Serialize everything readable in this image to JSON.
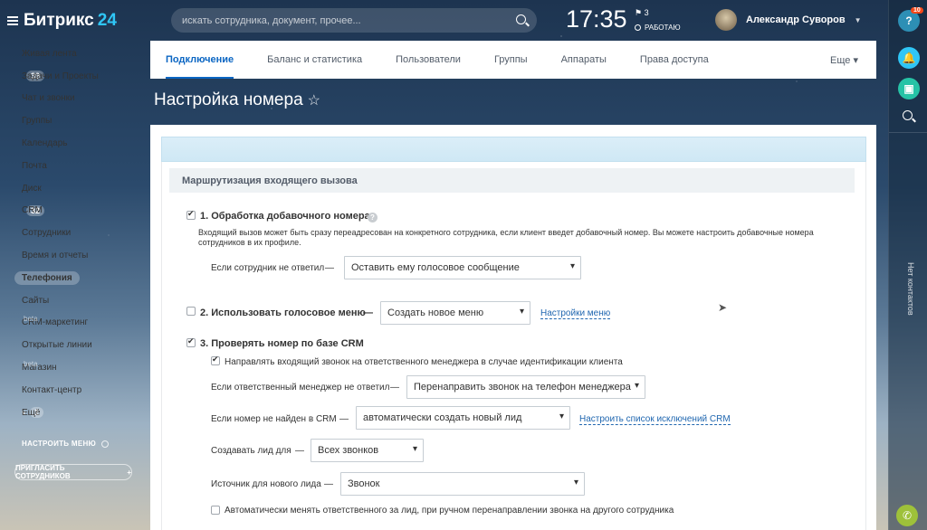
{
  "sidebar": {
    "logo": "Битрикс",
    "logo_num": "24",
    "items": [
      {
        "label": "Живая лента",
        "badge": ""
      },
      {
        "label": "Задачи и Проекты",
        "badge": "39"
      },
      {
        "label": "Чат и звонки",
        "badge": ""
      },
      {
        "label": "Группы",
        "badge": ""
      },
      {
        "label": "Календарь",
        "badge": ""
      },
      {
        "label": "Почта",
        "badge": ""
      },
      {
        "label": "Диск",
        "badge": ""
      },
      {
        "label": "CRM",
        "badge": "32"
      },
      {
        "label": "Сотрудники",
        "badge": ""
      },
      {
        "label": "Время и отчеты",
        "badge": ""
      },
      {
        "label": "Телефония",
        "badge": "",
        "active": true
      },
      {
        "label": "Сайты",
        "badge": ""
      },
      {
        "label": "CRM-маркетинг",
        "beta": "beta"
      },
      {
        "label": "Открытые линии",
        "badge": ""
      },
      {
        "label": "Магазин",
        "beta": "beta"
      },
      {
        "label": "Контакт-центр",
        "badge": ""
      },
      {
        "label": "Ещё",
        "badge": "1"
      }
    ],
    "configure": "НАСТРОИТЬ МЕНЮ",
    "invite": "ПРИГЛАСИТЬ СОТРУДНИКОВ"
  },
  "topbar": {
    "search_placeholder": "искать сотрудника, документ, прочее...",
    "clock": "17:35",
    "flag_count": "3",
    "work_status": "РАБОТАЮ",
    "user_name": "Александр Суворов"
  },
  "right_panel": {
    "help_count": "10",
    "no_contacts": "Нет контактов"
  },
  "tabs": [
    "Подключение",
    "Баланс и статистика",
    "Пользователи",
    "Группы",
    "Аппараты",
    "Права доступа"
  ],
  "tab_more": "Еще",
  "page_title": "Настройка номера",
  "section_title": "Маршрутизация входящего вызова",
  "opt1": {
    "label": "1. Обработка добавочного номера",
    "desc": "Входящий вызов может быть сразу переадресован на конкретного сотрудника, если клиент введет добавочный номер. Вы можете настроить добавочные номера сотрудников в их профиле.",
    "no_answer_label": "Если сотрудник не ответил",
    "no_answer_value": "Оставить ему голосовое сообщение"
  },
  "opt2": {
    "label": "2. Использовать голосовое меню",
    "value": "Создать новое меню",
    "link": "Настройки меню"
  },
  "opt3": {
    "label": "3. Проверять номер по базе CRM",
    "redirect_label": "Направлять входящий звонок на ответственного менеджера в случае идентификации клиента",
    "mgr_no_answer_label": "Если ответственный менеджер не ответил",
    "mgr_no_answer_value": "Перенаправить звонок на телефон менеджера",
    "not_found_label": "Если номер не найден в CRM",
    "not_found_value": "автоматически создать новый лид",
    "exclusions_link": "Настроить список исключений CRM",
    "create_lead_label": "Создавать лид для",
    "create_lead_value": "Всех звонков",
    "source_label": "Источник для нового лида",
    "source_value": "Звонок",
    "auto_change_label": "Автоматически менять ответственного за лид, при ручном перенаправлении звонка на другого сотрудника"
  },
  "dash": "—"
}
